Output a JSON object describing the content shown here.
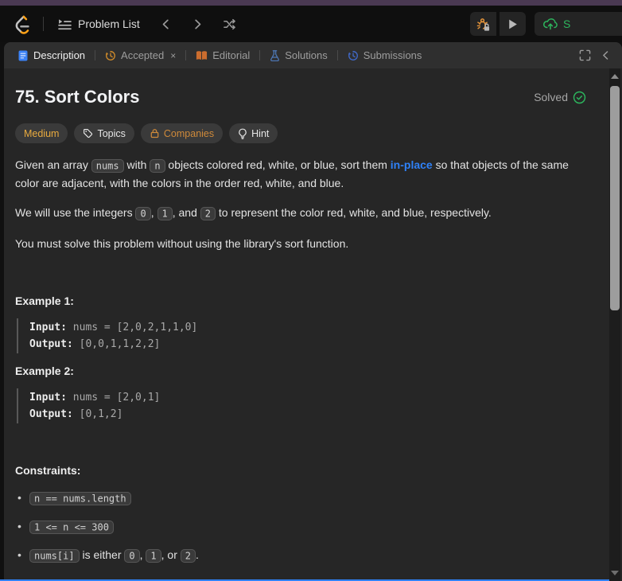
{
  "colors": {
    "top_strip_purple": "#4a3952",
    "brand_orange": "#ffa116",
    "accent_blue": "#2f81f7",
    "success_green": "#2db55d",
    "medium_amber": "#e9ab3f",
    "companies_orange": "#cf8a3a",
    "panel_bg": "#262626",
    "tabbar_bg": "#2f2f2f"
  },
  "nav": {
    "problem_list_label": "Problem List",
    "submit_visible_label": "S"
  },
  "tabs": {
    "description": {
      "label": "Description"
    },
    "accepted": {
      "label": "Accepted",
      "close": "×"
    },
    "editorial": {
      "label": "Editorial"
    },
    "solutions": {
      "label": "Solutions"
    },
    "submissions": {
      "label": "Submissions"
    }
  },
  "problem": {
    "title": "75. Sort Colors",
    "status": "Solved",
    "difficulty": "Medium",
    "topics_label": "Topics",
    "companies_label": "Companies",
    "hint_label": "Hint"
  },
  "description": {
    "p1": [
      {
        "t": "text",
        "v": "Given an array "
      },
      {
        "t": "code",
        "v": "nums"
      },
      {
        "t": "text",
        "v": " with "
      },
      {
        "t": "code",
        "v": "n"
      },
      {
        "t": "text",
        "v": " objects colored red, white, or blue, sort them "
      },
      {
        "t": "link",
        "v": "in-place"
      },
      {
        "t": "text",
        "v": " so that objects of the same color are adjacent, with the colors in the order red, white, and blue."
      }
    ],
    "p2": [
      {
        "t": "text",
        "v": "We will use the integers "
      },
      {
        "t": "code",
        "v": "0"
      },
      {
        "t": "text",
        "v": ", "
      },
      {
        "t": "code",
        "v": "1"
      },
      {
        "t": "text",
        "v": ", and "
      },
      {
        "t": "code",
        "v": "2"
      },
      {
        "t": "text",
        "v": " to represent the color red, white, and blue, respectively."
      }
    ],
    "p3": [
      {
        "t": "text",
        "v": "You must solve this problem without using the library's sort function."
      }
    ]
  },
  "examples": [
    {
      "label": "Example 1:",
      "input_label": "Input:",
      "input_value": " nums = [2,0,2,1,1,0]",
      "output_label": "Output:",
      "output_value": " [0,0,1,1,2,2]"
    },
    {
      "label": "Example 2:",
      "input_label": "Input:",
      "input_value": " nums = [2,0,1]",
      "output_label": "Output:",
      "output_value": " [0,1,2]"
    }
  ],
  "constraints": {
    "label": "Constraints:",
    "items": [
      [
        {
          "t": "code",
          "v": "n == nums.length"
        }
      ],
      [
        {
          "t": "code",
          "v": "1 <= n <= 300"
        }
      ],
      [
        {
          "t": "code",
          "v": "nums[i]"
        },
        {
          "t": "text",
          "v": " is either "
        },
        {
          "t": "code",
          "v": "0"
        },
        {
          "t": "text",
          "v": ", "
        },
        {
          "t": "code",
          "v": "1"
        },
        {
          "t": "text",
          "v": ", or "
        },
        {
          "t": "code",
          "v": "2"
        },
        {
          "t": "text",
          "v": "."
        }
      ]
    ]
  }
}
